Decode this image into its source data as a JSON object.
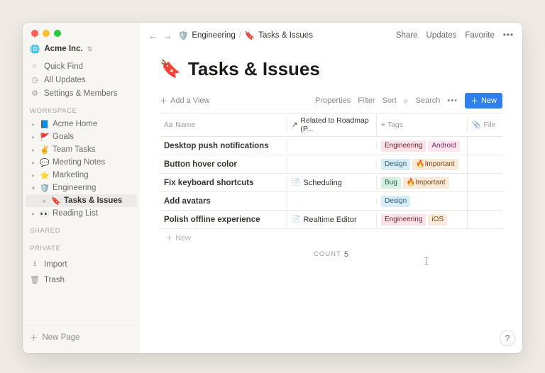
{
  "workspace": {
    "name": "Acme Inc."
  },
  "sidebar": {
    "quick_find": "Quick Find",
    "all_updates": "All Updates",
    "settings": "Settings & Members",
    "section_workspace": "WORKSPACE",
    "section_shared": "SHARED",
    "section_private": "PRIVATE",
    "import": "Import",
    "trash": "Trash",
    "new_page": "New Page",
    "items": [
      {
        "emoji": "📘",
        "label": "Acme Home"
      },
      {
        "emoji": "🚩",
        "label": "Goals"
      },
      {
        "emoji": "✌️",
        "label": "Team Tasks"
      },
      {
        "emoji": "💬",
        "label": "Meeting Notes"
      },
      {
        "emoji": "⭐",
        "label": "Marketing"
      },
      {
        "emoji": "🛡️",
        "label": "Engineering"
      },
      {
        "emoji": "🔖",
        "label": "Tasks & Issues"
      },
      {
        "emoji": "👀",
        "label": "Reading List"
      }
    ]
  },
  "breadcrumb": {
    "parent_emoji": "🛡️",
    "parent": "Engineering",
    "child_emoji": "🔖",
    "child": "Tasks & Issues"
  },
  "topbar": {
    "share": "Share",
    "updates": "Updates",
    "favorite": "Favorite"
  },
  "page": {
    "title_emoji": "🔖",
    "title": "Tasks & Issues"
  },
  "viewbar": {
    "add_view": "Add a View",
    "properties": "Properties",
    "filter": "Filter",
    "sort": "Sort",
    "search": "Search",
    "new": "New"
  },
  "table": {
    "col_name": "Name",
    "col_related": "Related to Roadmap (P...",
    "col_tags": "Tags",
    "col_file": "File",
    "rows": [
      {
        "name": "Desktop push notifications",
        "related": "",
        "tags": [
          "Engineering",
          "Android"
        ]
      },
      {
        "name": "Button hover color",
        "related": "",
        "tags": [
          "Design",
          "🔥Important"
        ]
      },
      {
        "name": "Fix keyboard shortcuts",
        "related": "Scheduling",
        "tags": [
          "Bug",
          "🔥Important"
        ]
      },
      {
        "name": "Add avatars",
        "related": "",
        "tags": [
          "Design"
        ]
      },
      {
        "name": "Polish offline experience",
        "related": "Realtime Editor",
        "tags": [
          "Engineering",
          "iOS"
        ]
      }
    ],
    "new_row": "New",
    "count_label": "COUNT",
    "count_value": "5"
  },
  "tag_classes": {
    "Engineering": "tag-eng",
    "Android": "tag-android",
    "Design": "tag-design",
    "🔥Important": "tag-important",
    "Bug": "tag-bug",
    "iOS": "tag-ios"
  }
}
